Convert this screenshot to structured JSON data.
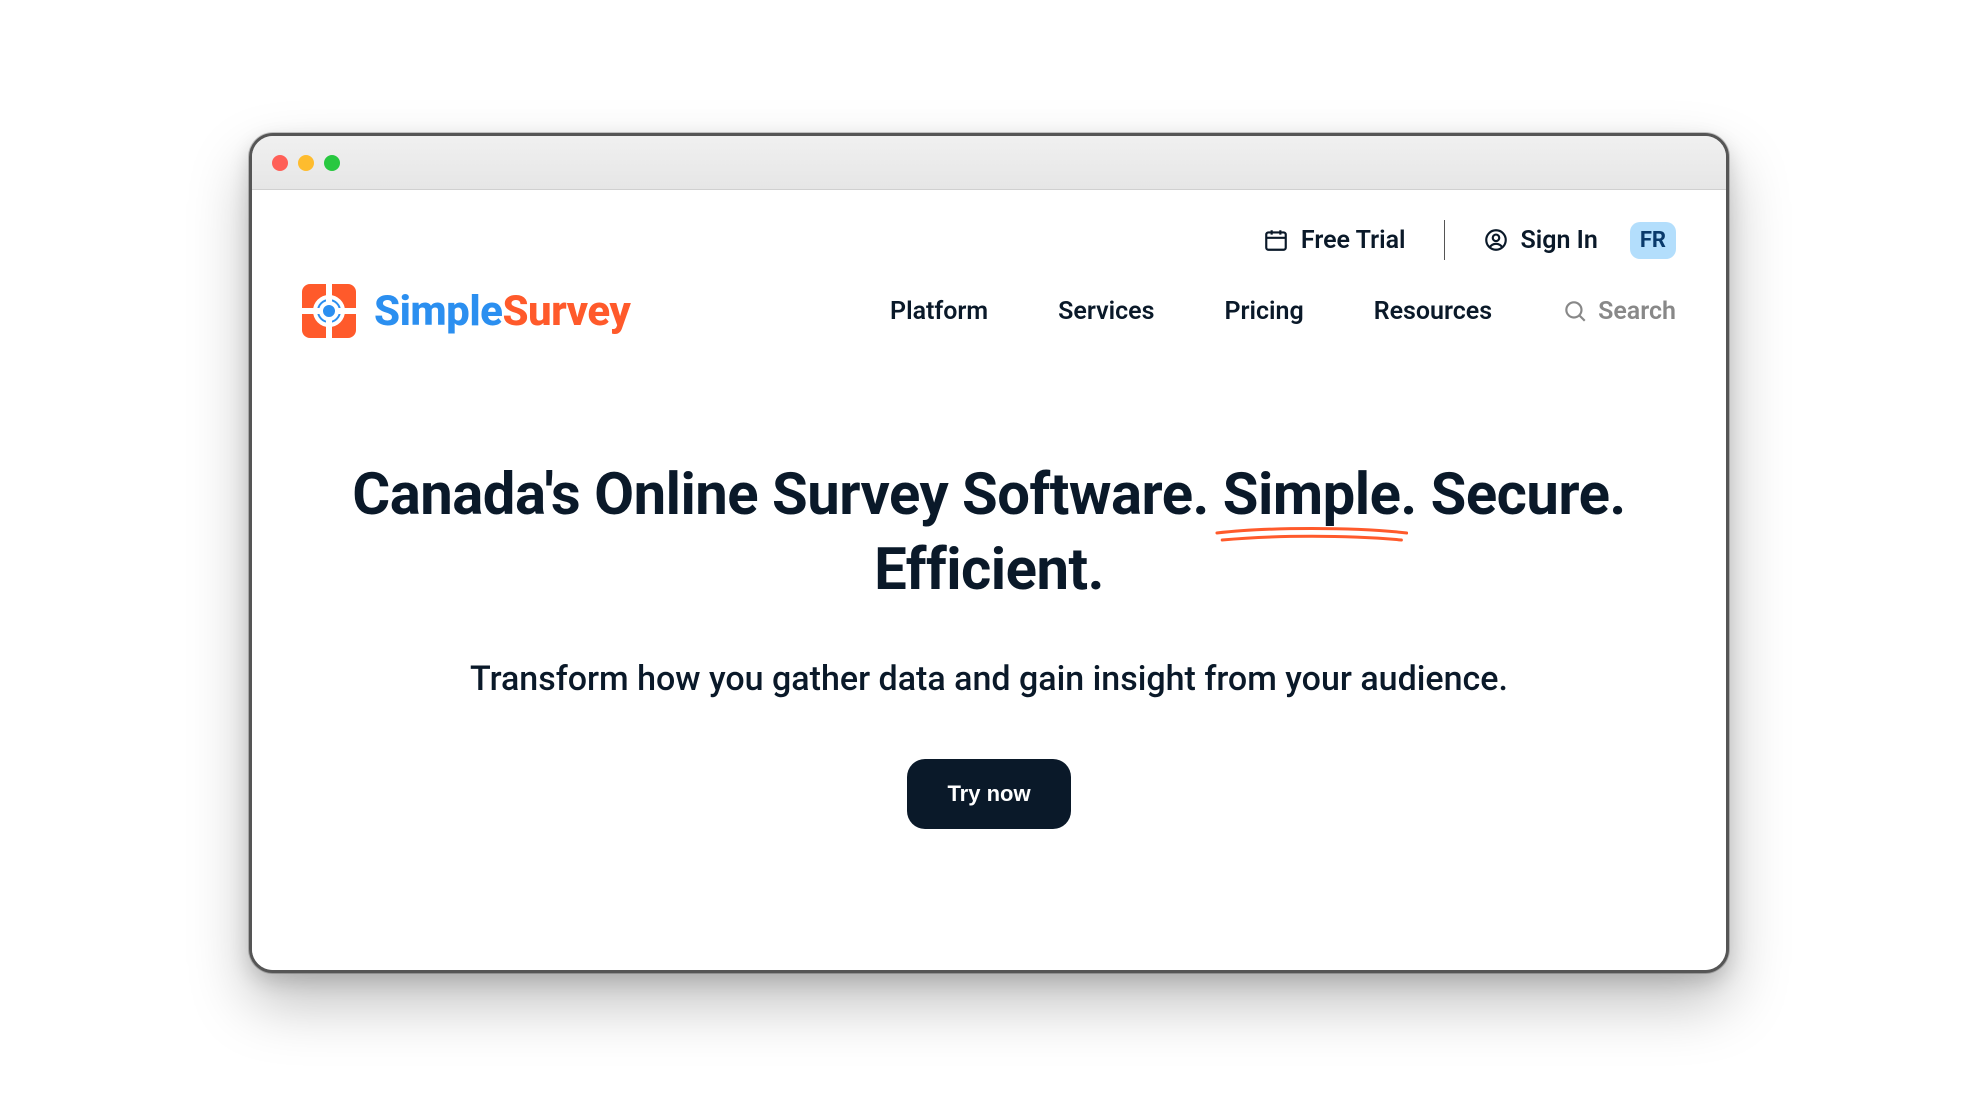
{
  "brand": {
    "part1": "Simple",
    "part2": "Survey"
  },
  "topbar": {
    "free_trial": "Free Trial",
    "sign_in": "Sign In",
    "lang": "FR"
  },
  "nav": {
    "items": [
      "Platform",
      "Services",
      "Pricing",
      "Resources"
    ],
    "search": "Search"
  },
  "hero": {
    "headline_pre": "Canada's Online Survey Software. ",
    "headline_underlined": "Simple",
    "headline_post": ". Secure. Efficient.",
    "sub": "Transform how you gather data and gain insight from your audience.",
    "cta": "Try now"
  }
}
